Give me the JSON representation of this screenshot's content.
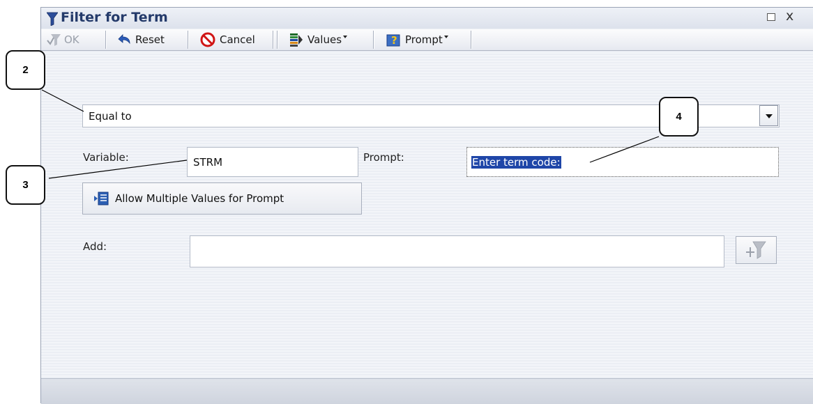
{
  "window": {
    "title": "Filter for Term"
  },
  "toolbar": {
    "ok_label": "OK",
    "reset_label": "Reset",
    "cancel_label": "Cancel",
    "values_label": "Values",
    "prompt_label": "Prompt"
  },
  "operator": {
    "value": "Equal to"
  },
  "variable": {
    "label": "Variable:",
    "value": "STRM"
  },
  "prompt": {
    "label": "Prompt:",
    "value": "Enter term code:"
  },
  "multi_values_button": {
    "label": "Allow Multiple Values for Prompt"
  },
  "add": {
    "label": "Add:",
    "value": ""
  },
  "callouts": [
    "2",
    "3",
    "4"
  ],
  "colors": {
    "title": "#243a6a",
    "selection": "#1f46a8"
  }
}
